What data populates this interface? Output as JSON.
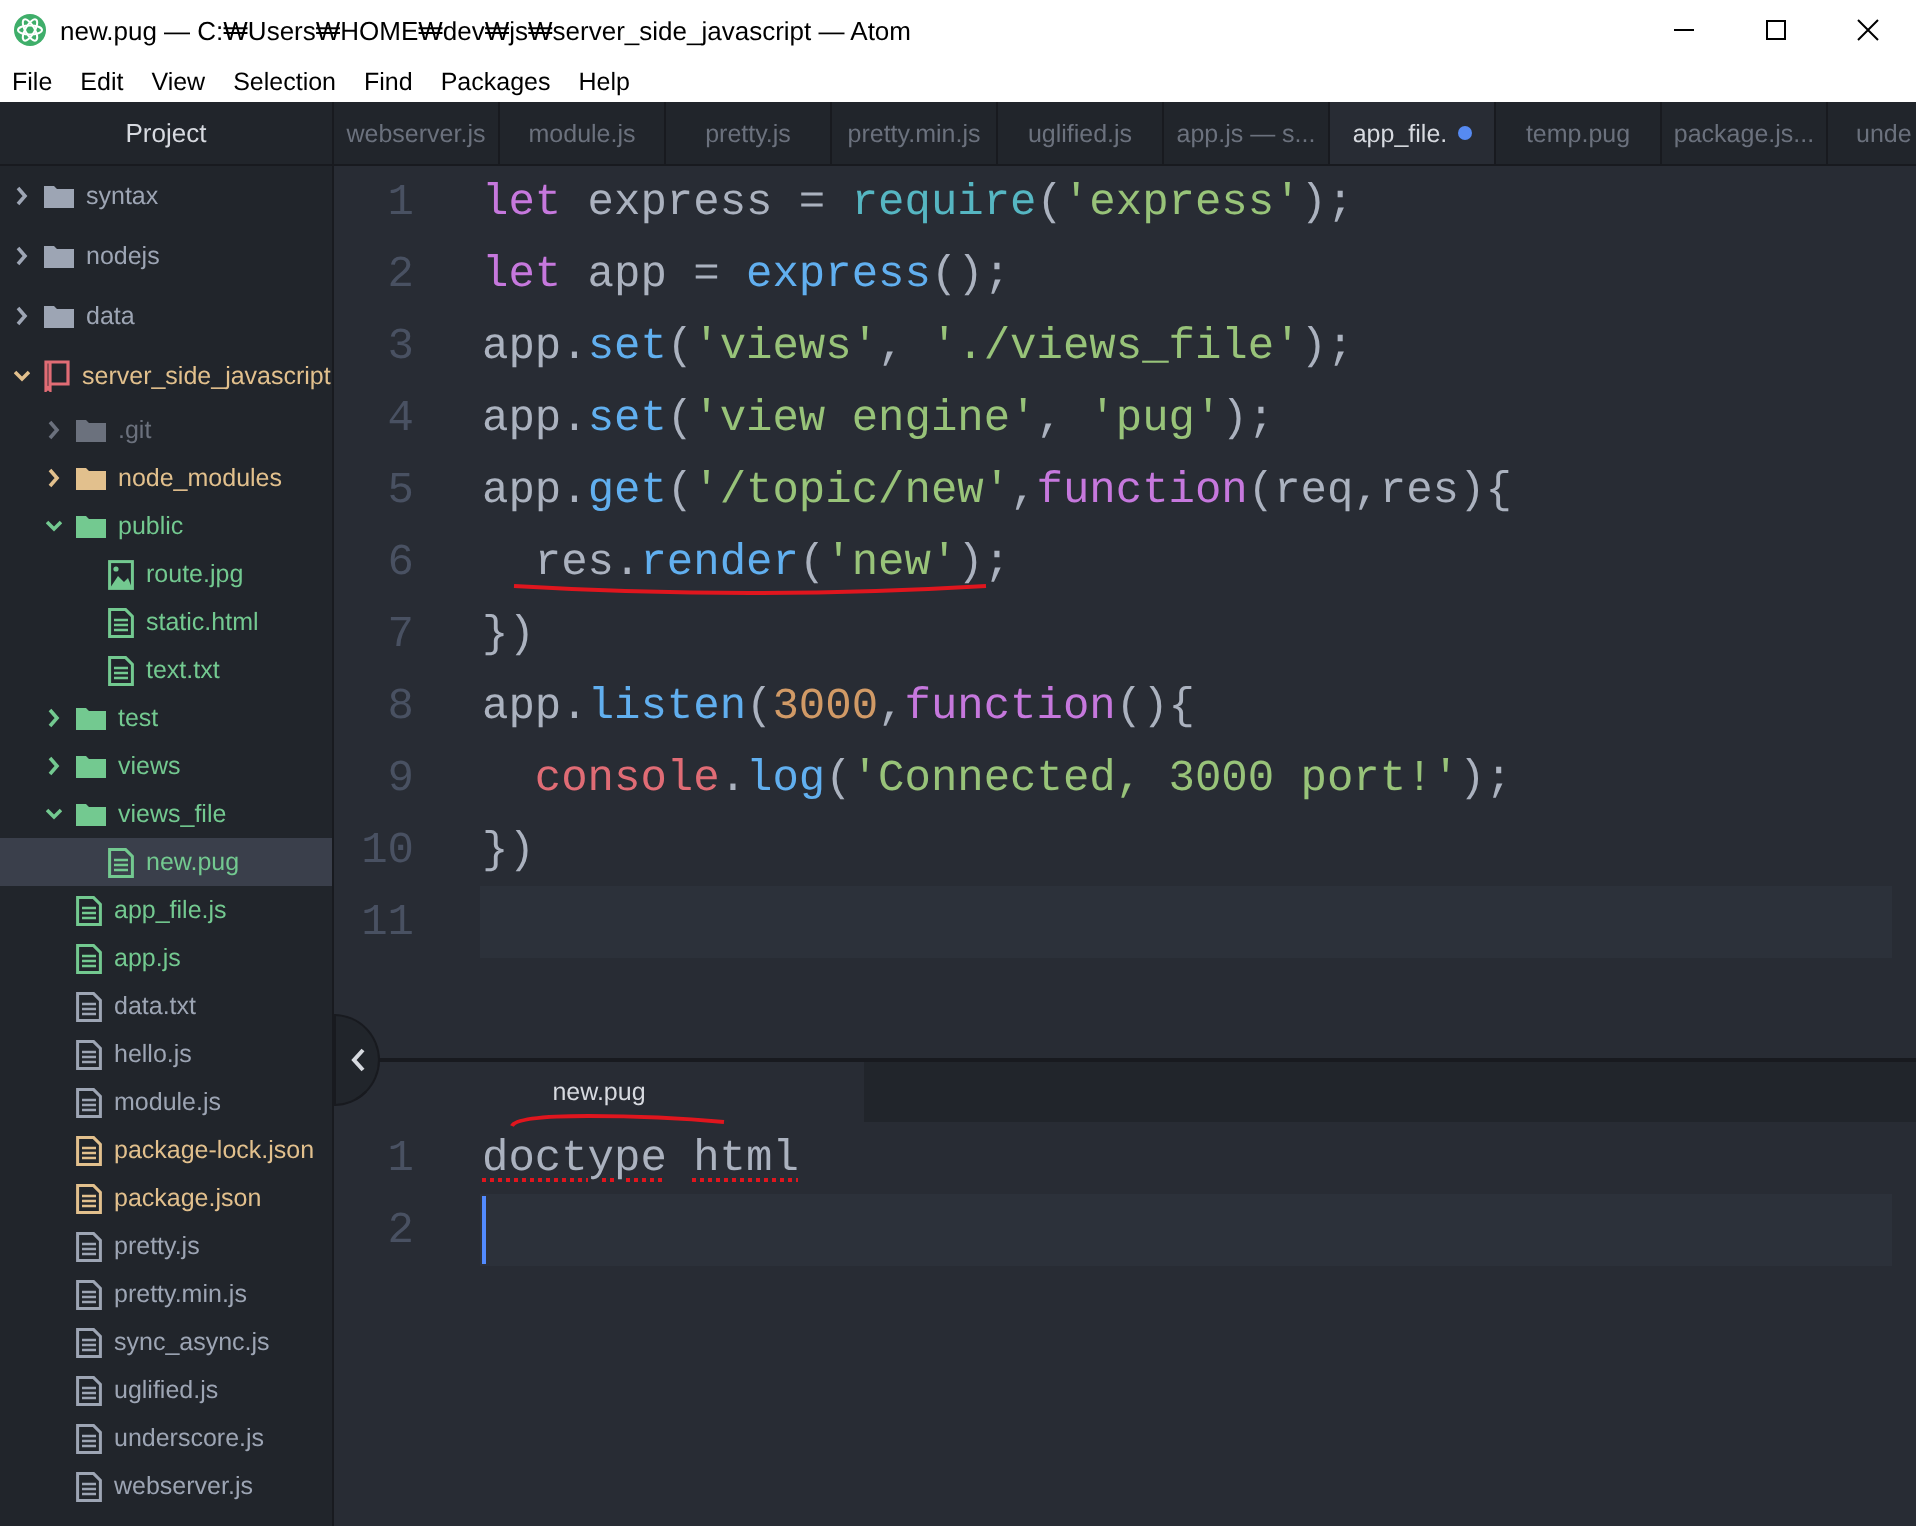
{
  "window": {
    "title": "new.pug — C:₩Users₩HOME₩dev₩js₩server_side_javascript — Atom"
  },
  "menu": [
    "File",
    "Edit",
    "View",
    "Selection",
    "Find",
    "Packages",
    "Help"
  ],
  "sidebar": {
    "title": "Project",
    "tree": [
      {
        "name": "syntax",
        "kind": "folder",
        "color": "#9da5b4",
        "expanded": false,
        "selected": false
      },
      {
        "name": "nodejs",
        "kind": "folder",
        "color": "#9da5b4",
        "expanded": false,
        "selected": false
      },
      {
        "name": "data",
        "kind": "folder",
        "color": "#9da5b4",
        "expanded": false,
        "selected": false
      },
      {
        "name": "server_side_javascript",
        "kind": "repo",
        "color": "#e2c08d",
        "expanded": true,
        "selected": false,
        "children": [
          {
            "name": ".git",
            "kind": "folder",
            "color": "#6b717d",
            "expanded": false,
            "selected": false
          },
          {
            "name": "node_modules",
            "kind": "folder",
            "color": "#e2c08d",
            "expanded": false,
            "selected": false
          },
          {
            "name": "public",
            "kind": "folder",
            "color": "#73c990",
            "expanded": true,
            "selected": false,
            "children": [
              {
                "name": "route.jpg",
                "kind": "image",
                "color": "#73c990",
                "selected": false
              },
              {
                "name": "static.html",
                "kind": "file",
                "color": "#73c990",
                "selected": false
              },
              {
                "name": "text.txt",
                "kind": "file",
                "color": "#73c990",
                "selected": false
              }
            ]
          },
          {
            "name": "test",
            "kind": "folder",
            "color": "#73c990",
            "expanded": false,
            "selected": false
          },
          {
            "name": "views",
            "kind": "folder",
            "color": "#73c990",
            "expanded": false,
            "selected": false
          },
          {
            "name": "views_file",
            "kind": "folder",
            "color": "#73c990",
            "expanded": true,
            "selected": false,
            "children": [
              {
                "name": "new.pug",
                "kind": "file",
                "color": "#73c990",
                "selected": true
              }
            ]
          },
          {
            "name": "app_file.js",
            "kind": "file",
            "color": "#73c990",
            "selected": false
          },
          {
            "name": "app.js",
            "kind": "file",
            "color": "#73c990",
            "selected": false
          },
          {
            "name": "data.txt",
            "kind": "file",
            "color": "#9da5b4",
            "selected": false
          },
          {
            "name": "hello.js",
            "kind": "file",
            "color": "#9da5b4",
            "selected": false
          },
          {
            "name": "module.js",
            "kind": "file",
            "color": "#9da5b4",
            "selected": false
          },
          {
            "name": "package-lock.json",
            "kind": "file",
            "color": "#e2c08d",
            "selected": false
          },
          {
            "name": "package.json",
            "kind": "file",
            "color": "#e2c08d",
            "selected": false
          },
          {
            "name": "pretty.js",
            "kind": "file",
            "color": "#9da5b4",
            "selected": false
          },
          {
            "name": "pretty.min.js",
            "kind": "file",
            "color": "#9da5b4",
            "selected": false
          },
          {
            "name": "sync_async.js",
            "kind": "file",
            "color": "#9da5b4",
            "selected": false
          },
          {
            "name": "uglified.js",
            "kind": "file",
            "color": "#9da5b4",
            "selected": false
          },
          {
            "name": "underscore.js",
            "kind": "file",
            "color": "#9da5b4",
            "selected": false
          },
          {
            "name": "webserver.js",
            "kind": "file",
            "color": "#9da5b4",
            "selected": false
          }
        ]
      }
    ]
  },
  "tabs": [
    {
      "label": "webserver.js",
      "selected": false,
      "modified": false
    },
    {
      "label": "module.js",
      "selected": false,
      "modified": false
    },
    {
      "label": "pretty.js",
      "selected": false,
      "modified": false
    },
    {
      "label": "pretty.min.js",
      "selected": false,
      "modified": false
    },
    {
      "label": "uglified.js",
      "selected": false,
      "modified": false
    },
    {
      "label": "app.js — s...",
      "selected": false,
      "modified": false
    },
    {
      "label": "app_file.",
      "selected": true,
      "modified": true
    },
    {
      "label": "temp.pug",
      "selected": false,
      "modified": false
    },
    {
      "label": "package.js...",
      "selected": false,
      "modified": false
    },
    {
      "label": "unde",
      "selected": false,
      "modified": false
    }
  ],
  "editor": {
    "lines": [
      {
        "number": "1",
        "current": false,
        "annotated": false,
        "tokens": [
          {
            "kind": "keyword",
            "text": "let"
          },
          {
            "kind": "plain",
            "text": " express = "
          },
          {
            "kind": "builtin",
            "text": "require"
          },
          {
            "kind": "plain",
            "text": "("
          },
          {
            "kind": "string",
            "text": "'express'"
          },
          {
            "kind": "plain",
            "text": ");"
          }
        ]
      },
      {
        "number": "2",
        "current": false,
        "annotated": false,
        "tokens": [
          {
            "kind": "keyword",
            "text": "let"
          },
          {
            "kind": "plain",
            "text": " app = "
          },
          {
            "kind": "function",
            "text": "express"
          },
          {
            "kind": "plain",
            "text": "();"
          }
        ]
      },
      {
        "number": "3",
        "current": false,
        "annotated": false,
        "tokens": [
          {
            "kind": "plain",
            "text": "app."
          },
          {
            "kind": "function",
            "text": "set"
          },
          {
            "kind": "plain",
            "text": "("
          },
          {
            "kind": "string",
            "text": "'views'"
          },
          {
            "kind": "plain",
            "text": ", "
          },
          {
            "kind": "string",
            "text": "'./views_file'"
          },
          {
            "kind": "plain",
            "text": ");"
          }
        ]
      },
      {
        "number": "4",
        "current": false,
        "annotated": false,
        "tokens": [
          {
            "kind": "plain",
            "text": "app."
          },
          {
            "kind": "function",
            "text": "set"
          },
          {
            "kind": "plain",
            "text": "("
          },
          {
            "kind": "string",
            "text": "'view engine'"
          },
          {
            "kind": "plain",
            "text": ", "
          },
          {
            "kind": "string",
            "text": "'pug'"
          },
          {
            "kind": "plain",
            "text": ");"
          }
        ]
      },
      {
        "number": "5",
        "current": false,
        "annotated": false,
        "tokens": [
          {
            "kind": "plain",
            "text": "app."
          },
          {
            "kind": "function",
            "text": "get"
          },
          {
            "kind": "plain",
            "text": "("
          },
          {
            "kind": "string",
            "text": "'/topic/new'"
          },
          {
            "kind": "plain",
            "text": ","
          },
          {
            "kind": "keyword",
            "text": "function"
          },
          {
            "kind": "plain",
            "text": "(req,res){"
          }
        ]
      },
      {
        "number": "6",
        "current": false,
        "annotated": true,
        "tokens": [
          {
            "kind": "plain",
            "text": "  res."
          },
          {
            "kind": "function",
            "text": "render"
          },
          {
            "kind": "plain",
            "text": "("
          },
          {
            "kind": "string",
            "text": "'new'"
          },
          {
            "kind": "plain",
            "text": ");"
          }
        ]
      },
      {
        "number": "7",
        "current": false,
        "annotated": false,
        "tokens": [
          {
            "kind": "plain",
            "text": "})"
          }
        ]
      },
      {
        "number": "8",
        "current": false,
        "annotated": false,
        "tokens": [
          {
            "kind": "plain",
            "text": "app."
          },
          {
            "kind": "function",
            "text": "listen"
          },
          {
            "kind": "plain",
            "text": "("
          },
          {
            "kind": "number",
            "text": "3000"
          },
          {
            "kind": "plain",
            "text": ","
          },
          {
            "kind": "keyword",
            "text": "function"
          },
          {
            "kind": "plain",
            "text": "(){"
          }
        ]
      },
      {
        "number": "9",
        "current": false,
        "annotated": false,
        "tokens": [
          {
            "kind": "variable",
            "text": "  console"
          },
          {
            "kind": "plain",
            "text": "."
          },
          {
            "kind": "function",
            "text": "log"
          },
          {
            "kind": "plain",
            "text": "("
          },
          {
            "kind": "string",
            "text": "'Connected, 3000 port!'"
          },
          {
            "kind": "plain",
            "text": ");"
          }
        ]
      },
      {
        "number": "10",
        "current": false,
        "annotated": false,
        "tokens": [
          {
            "kind": "plain",
            "text": "})"
          }
        ]
      },
      {
        "number": "11",
        "current": true,
        "annotated": false
      }
    ]
  },
  "bottom_pane": {
    "tab": {
      "label": "new.pug",
      "selected": true,
      "annotated": true
    },
    "lines": [
      {
        "number": "1",
        "current": false,
        "words": [
          {
            "text": "doctype",
            "misspelled": true
          },
          {
            "text": "html",
            "misspelled": true
          }
        ]
      },
      {
        "number": "2",
        "current": true
      }
    ]
  }
}
